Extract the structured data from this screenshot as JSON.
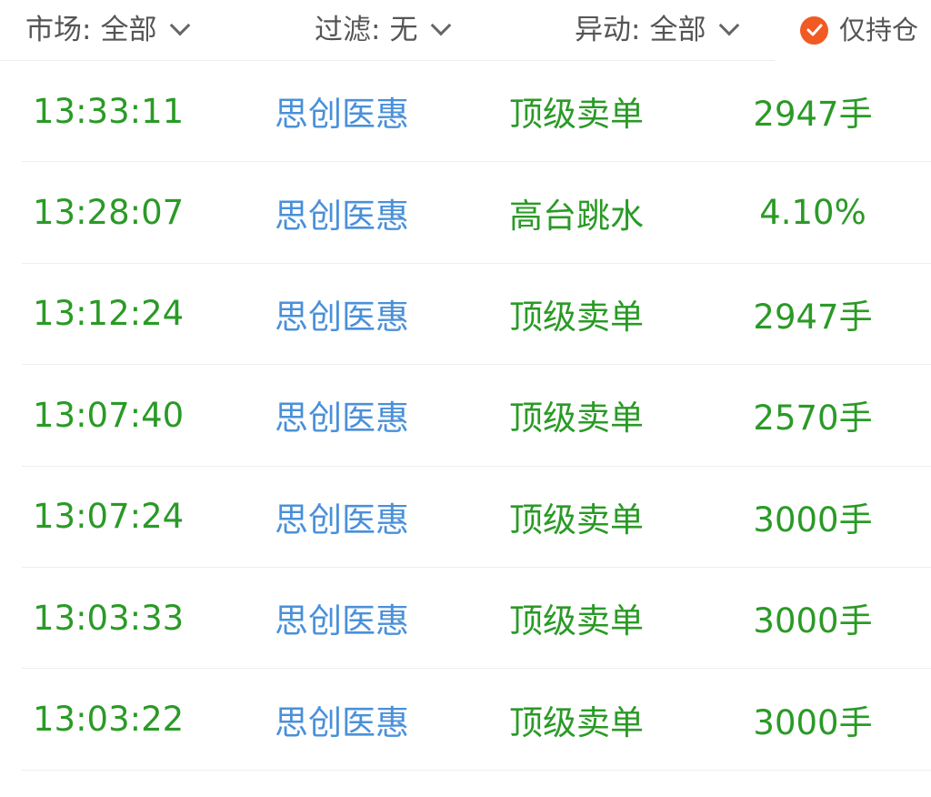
{
  "filters": {
    "market": {
      "label": "市场:",
      "value": "全部"
    },
    "filter": {
      "label": "过滤:",
      "value": "无"
    },
    "movement": {
      "label": "异动:",
      "value": "全部"
    },
    "holding_only": {
      "label": "仅持仓",
      "checked": true
    }
  },
  "colors": {
    "accent": "#f15a22",
    "green": "#2a9a26",
    "blue": "#4a90d9",
    "divider": "#eeeeee"
  },
  "rows": [
    {
      "time": "13:33:11",
      "name": "思创医惠",
      "type": "顶级卖单",
      "value": "2947手"
    },
    {
      "time": "13:28:07",
      "name": "思创医惠",
      "type": "高台跳水",
      "value": "4.10%"
    },
    {
      "time": "13:12:24",
      "name": "思创医惠",
      "type": "顶级卖单",
      "value": "2947手"
    },
    {
      "time": "13:07:40",
      "name": "思创医惠",
      "type": "顶级卖单",
      "value": "2570手"
    },
    {
      "time": "13:07:24",
      "name": "思创医惠",
      "type": "顶级卖单",
      "value": "3000手"
    },
    {
      "time": "13:03:33",
      "name": "思创医惠",
      "type": "顶级卖单",
      "value": "3000手"
    },
    {
      "time": "13:03:22",
      "name": "思创医惠",
      "type": "顶级卖单",
      "value": "3000手"
    }
  ]
}
